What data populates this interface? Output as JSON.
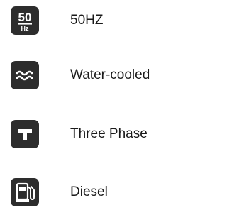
{
  "specs": [
    {
      "icon": "frequency-50hz-icon",
      "icon_main_text": "50",
      "icon_sub_text": "Hz",
      "label": "50HZ"
    },
    {
      "icon": "water-waves-icon",
      "label": "Water-cooled"
    },
    {
      "icon": "three-phase-icon",
      "label": "Three Phase"
    },
    {
      "icon": "fuel-pump-icon",
      "label": "Diesel"
    }
  ],
  "colors": {
    "icon_background": "#2d2d2d",
    "icon_foreground": "#ffffff",
    "label_text": "#1a1a1a",
    "page_background": "#ffffff"
  }
}
